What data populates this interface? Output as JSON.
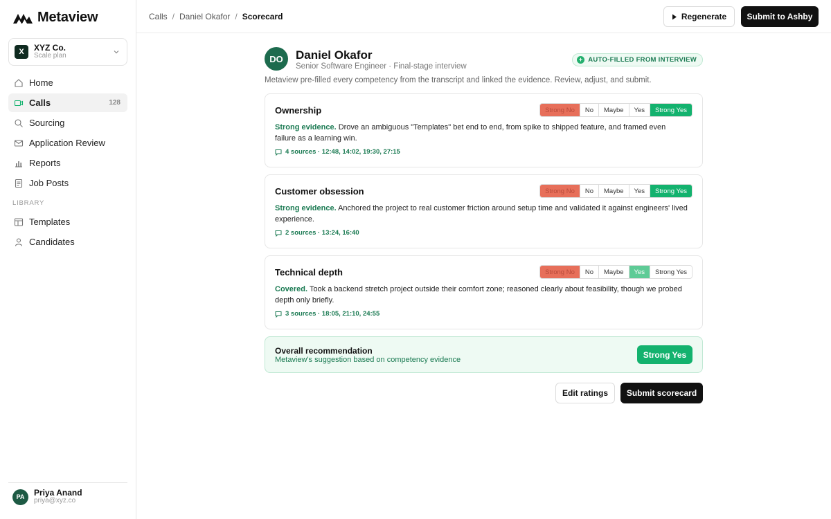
{
  "app": {
    "name": "Metaview"
  },
  "org": {
    "name": "XYZ Co.",
    "plan": "Scale plan",
    "badge": "X"
  },
  "nav": {
    "items": [
      {
        "label": "Home",
        "icon": "home-icon"
      },
      {
        "label": "Calls",
        "icon": "video-icon",
        "count": "128",
        "active": true
      },
      {
        "label": "Sourcing",
        "icon": "search-icon"
      },
      {
        "label": "Application Review",
        "icon": "mail-icon"
      },
      {
        "label": "Reports",
        "icon": "bar-chart-icon"
      },
      {
        "label": "Job Posts",
        "icon": "document-icon"
      }
    ],
    "library_label": "LIBRARY",
    "library": [
      {
        "label": "Templates",
        "icon": "template-icon"
      },
      {
        "label": "Candidates",
        "icon": "person-icon"
      }
    ]
  },
  "user": {
    "name": "Priya Anand",
    "email": "priya@xyz.co",
    "initials": "PA"
  },
  "breadcrumb": [
    "Calls",
    "Daniel Okafor",
    "Scorecard"
  ],
  "header": {
    "regenerate_label": "Regenerate",
    "submit_ashby_label": "Submit to Ashby"
  },
  "candidate": {
    "initials": "DO",
    "name": "Daniel Okafor",
    "role": "Senior Software Engineer · Final-stage interview",
    "autofill_badge": "AUTO-FILLED FROM INTERVIEW"
  },
  "intro": "Metaview pre-filled every competency from the transcript and linked the evidence. Review, adjust, and submit.",
  "rating_options": [
    "Strong No",
    "No",
    "Maybe",
    "Yes",
    "Strong Yes"
  ],
  "competencies": [
    {
      "title": "Ownership",
      "selected": "Strong Yes",
      "level": "Strong evidence.",
      "evidence": "Drove an ambiguous \"Templates\" bet end to end, from spike to shipped feature, and framed even failure as a learning win.",
      "sources": "4 sources · 12:48, 14:02, 19:30, 27:15"
    },
    {
      "title": "Customer obsession",
      "selected": "Strong Yes",
      "level": "Strong evidence.",
      "evidence": "Anchored the project to real customer friction around setup time and validated it against engineers' lived experience.",
      "sources": "2 sources · 13:24, 16:40"
    },
    {
      "title": "Technical depth",
      "selected": "Yes",
      "level": "Covered.",
      "evidence": "Took a backend stretch project outside their comfort zone; reasoned clearly about feasibility, though we probed depth only briefly.",
      "sources": "3 sources · 18:05, 21:10, 24:55"
    }
  ],
  "overall": {
    "title": "Overall recommendation",
    "subtitle": "Metaview's suggestion based on competency evidence",
    "value": "Strong Yes"
  },
  "actions": {
    "edit_label": "Edit ratings",
    "submit_label": "Submit scorecard"
  },
  "colors": {
    "accent": "#13b26e",
    "accent_dark": "#1a7a52",
    "negative": "#e76f5a",
    "dark": "#111111"
  }
}
